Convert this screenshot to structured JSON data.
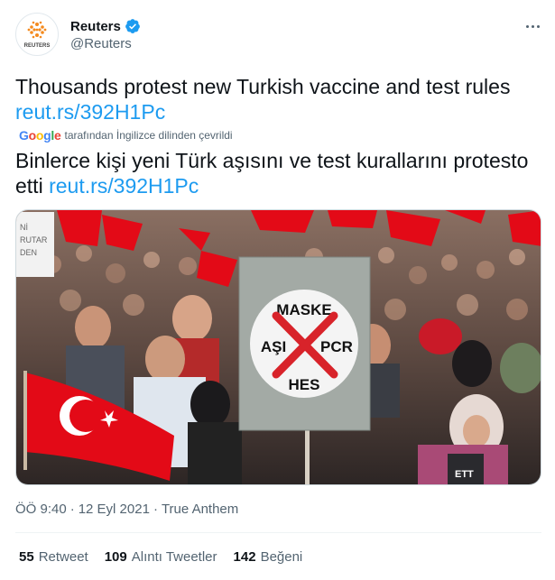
{
  "author": {
    "name": "Reuters",
    "handle": "@Reuters",
    "logo_text": "REUTERS"
  },
  "tweet": {
    "text": "Thousands protest new Turkish vaccine and test rules",
    "link": "reut.rs/392H1Pc"
  },
  "translation": {
    "provider": "Google",
    "note": "tarafından İngilizce dilinden çevrildi",
    "text": "Binlerce kişi yeni Türk aşısını ve test kurallarını protesto etti",
    "link": "reut.rs/392H1Pc"
  },
  "media": {
    "sign": {
      "top": "MASKE",
      "left": "AŞI",
      "right": "PCR",
      "bottom": "HES"
    },
    "left_placard": "Nİ\nRUTAR\nDEN",
    "headscarf_text": "ETT"
  },
  "meta": {
    "time": "ÖÖ 9:40",
    "separator": "·",
    "date": "12 Eyl 2021",
    "source": "True Anthem"
  },
  "stats": {
    "retweets": {
      "count": "55",
      "label": "Retweet"
    },
    "quotes": {
      "count": "109",
      "label": "Alıntı Tweetler"
    },
    "likes": {
      "count": "142",
      "label": "Beğeni"
    }
  },
  "colors": {
    "link": "#1d9bf0",
    "verified": "#1d9bf0",
    "secondary_text": "#536471",
    "reuters_orange": "#f48a1e",
    "flag_red": "#e30a17",
    "sign_x_red": "#d8232a"
  },
  "icons": {
    "verified": "verified-badge-icon",
    "more": "more-options-icon",
    "logo": "reuters-logo-icon"
  }
}
